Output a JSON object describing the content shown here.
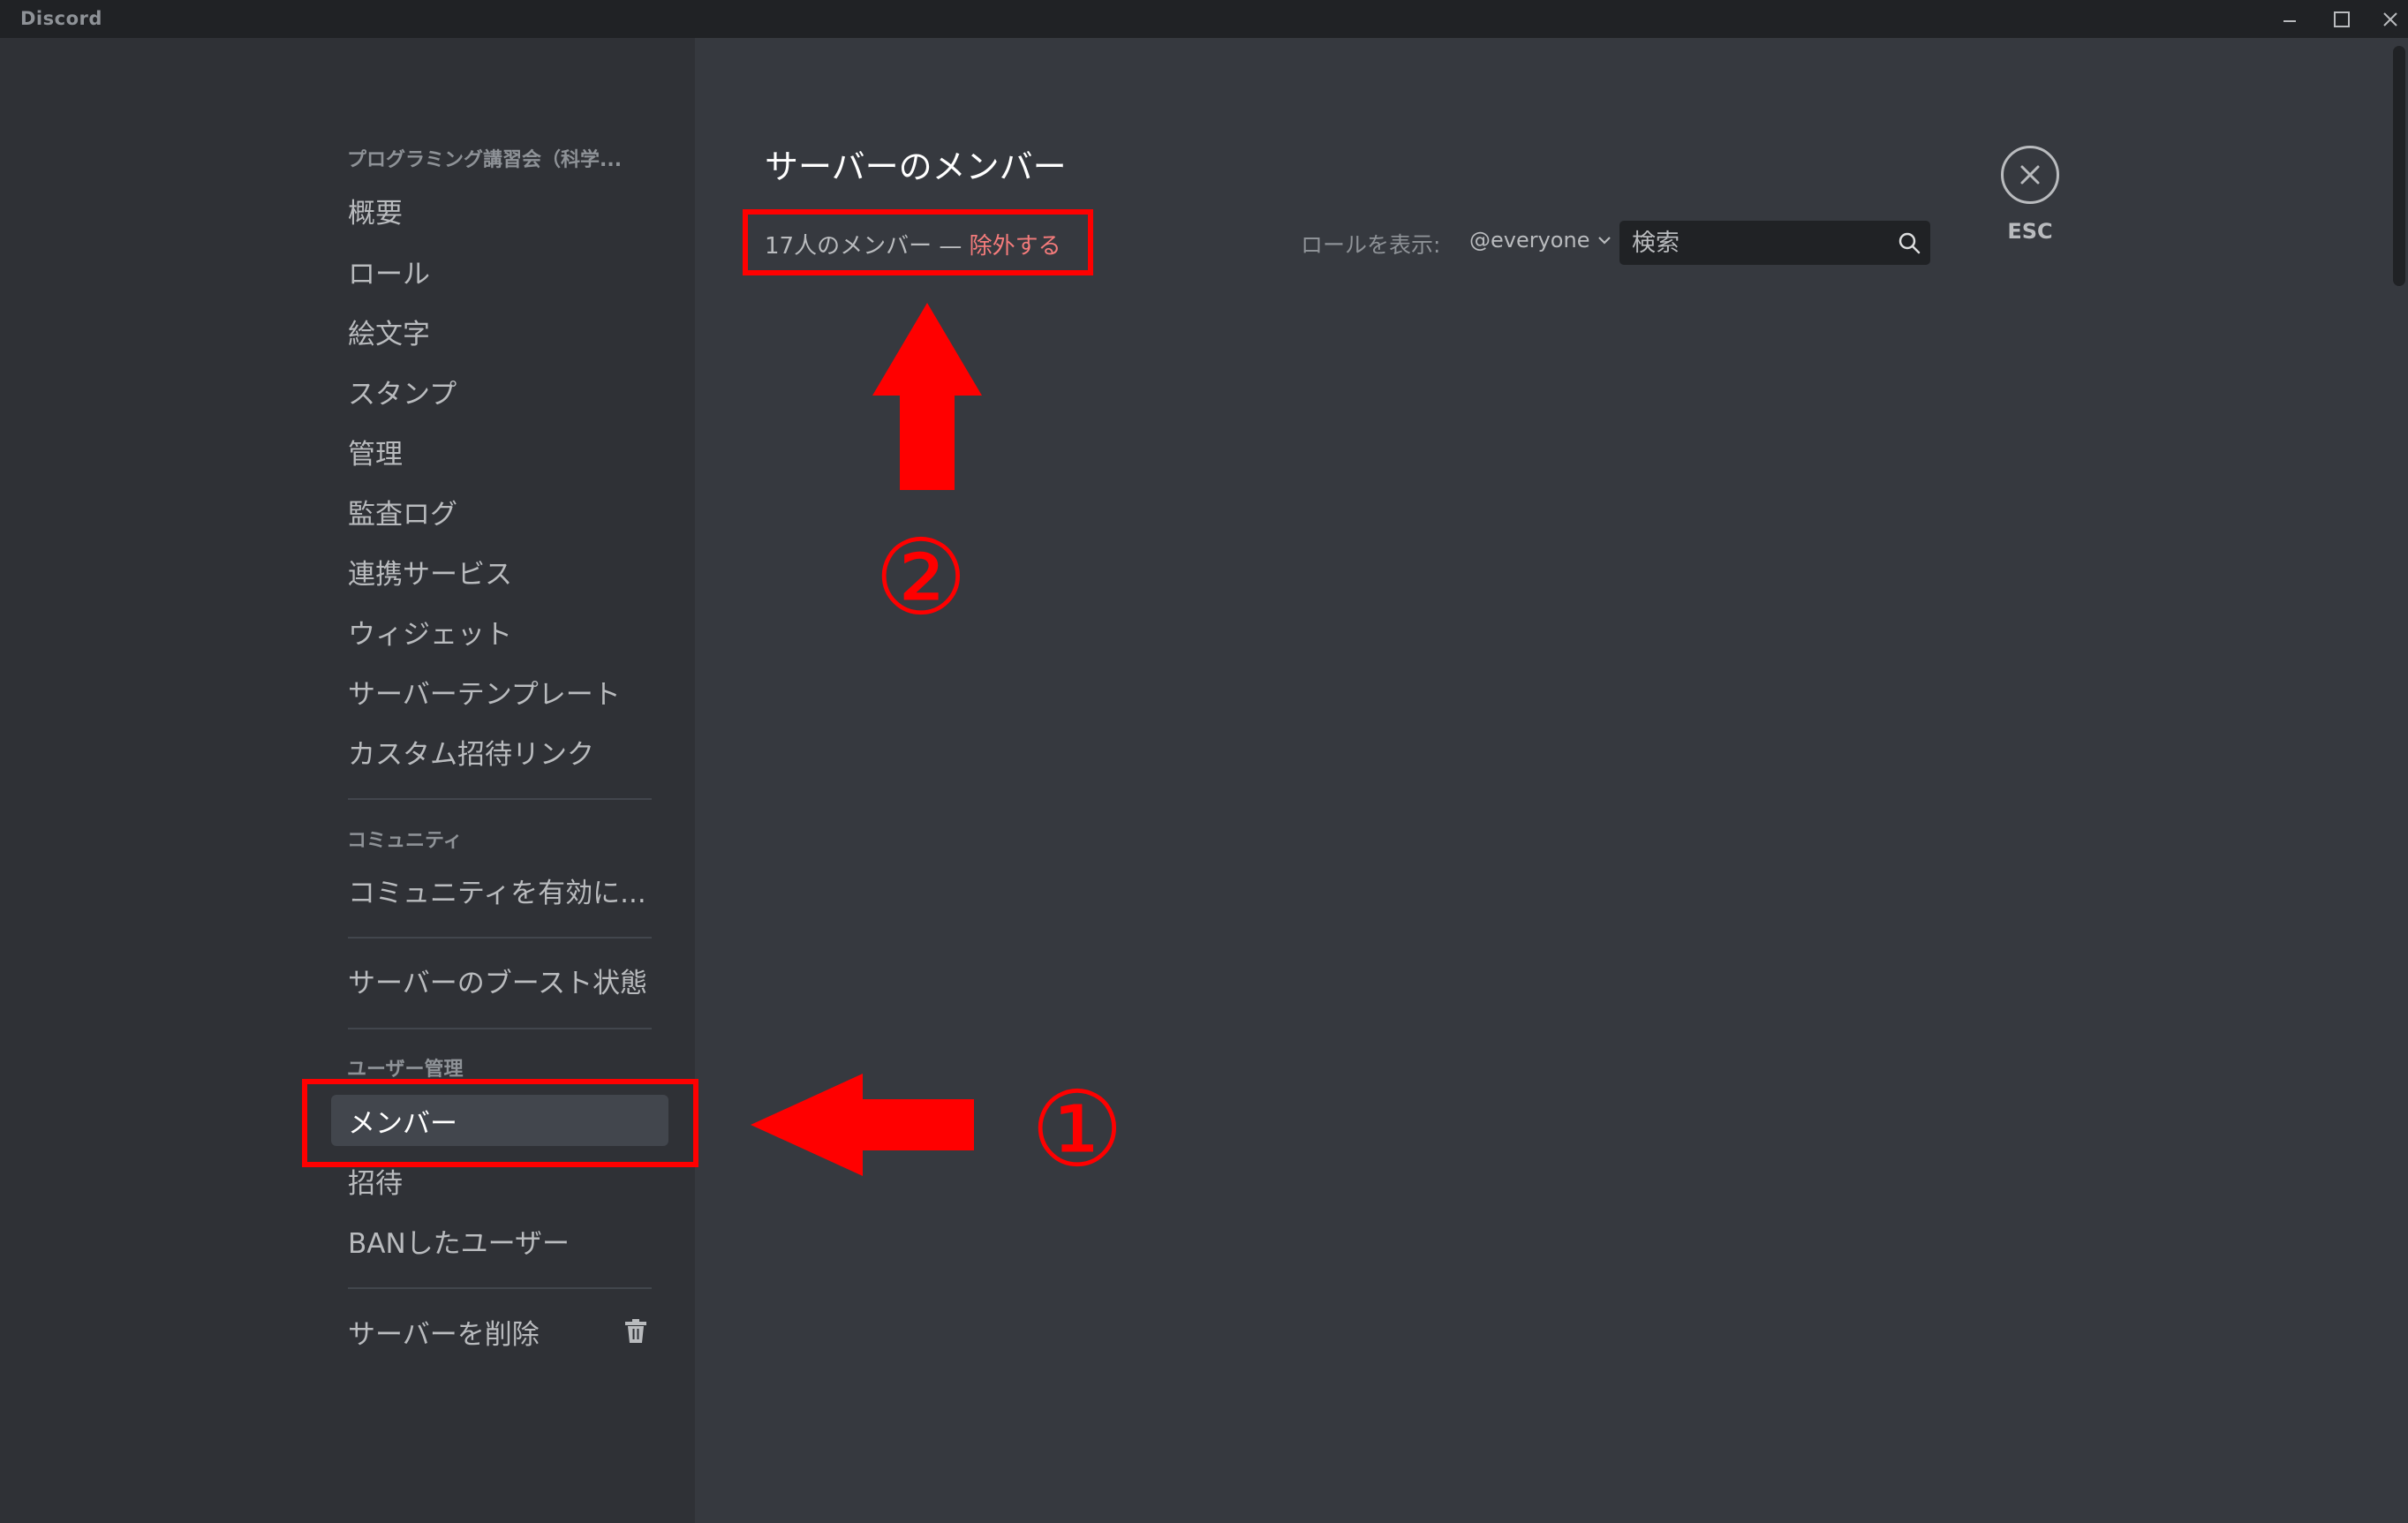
{
  "window": {
    "app_title": "Discord",
    "controls": [
      "minimize",
      "maximize",
      "close"
    ]
  },
  "sidebar": {
    "server_name": "プログラミング講習会（科学...",
    "settings_items": [
      {
        "label": "概要"
      },
      {
        "label": "ロール"
      },
      {
        "label": "絵文字"
      },
      {
        "label": "スタンプ"
      },
      {
        "label": "管理"
      },
      {
        "label": "監査ログ"
      },
      {
        "label": "連携サービス"
      },
      {
        "label": "ウィジェット"
      },
      {
        "label": "サーバーテンプレート"
      },
      {
        "label": "カスタム招待リンク"
      }
    ],
    "community_header": "コミュニティ",
    "community_items": [
      {
        "label": "コミュニティを有効に..."
      }
    ],
    "boost_item": "サーバーのブースト状態",
    "user_mgmt_header": "ユーザー管理",
    "user_mgmt_items": [
      {
        "label": "メンバー",
        "active": true
      },
      {
        "label": "招待"
      },
      {
        "label": "BANしたユーザー"
      }
    ],
    "delete_server": "サーバーを削除"
  },
  "main": {
    "title": "サーバーのメンバー",
    "member_count": "17人のメンバー — ",
    "prune_link": "除外する",
    "role_label": "ロールを表示:",
    "role_selected": "@everyone",
    "search": {
      "placeholder": "検索",
      "value": ""
    },
    "esc_label": "ESC"
  },
  "annotations": {
    "step1": "①",
    "step2": "②",
    "color": "#ff0000"
  },
  "theme": {
    "titlebar": "#202225",
    "sidebar": "#2f3136",
    "content": "#36393f",
    "active_item": "#42464d",
    "danger_link": "#f47b7b"
  }
}
